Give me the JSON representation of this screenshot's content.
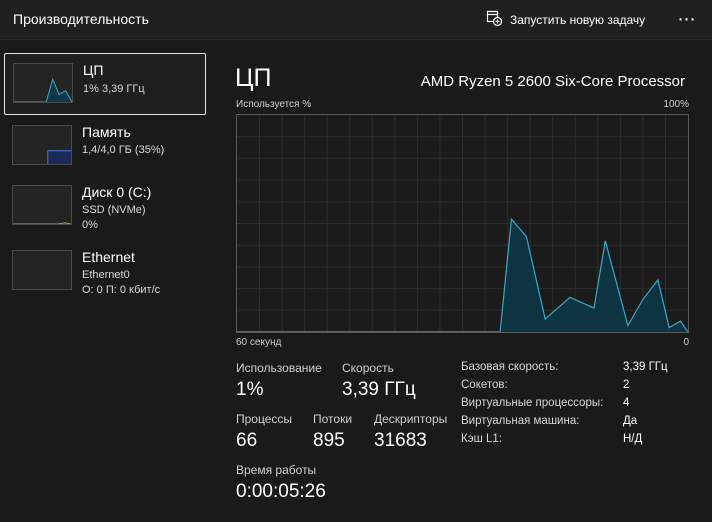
{
  "header": {
    "title": "Производительность",
    "new_task_label": "Запустить новую задачу",
    "new_task_icon": "new-task-icon",
    "more_icon": "more-options-icon",
    "more_glyph": "⋯"
  },
  "sidebar": {
    "items": [
      {
        "name": "ЦП",
        "sub1": "1% 3,39 ГГц",
        "sub2": "",
        "active": true
      },
      {
        "name": "Память",
        "sub1": "1,4/4,0 ГБ (35%)",
        "sub2": "",
        "active": false
      },
      {
        "name": "Диск 0 (C:)",
        "sub1": "SSD (NVMe)",
        "sub2": "0%",
        "active": false
      },
      {
        "name": "Ethernet",
        "sub1": "Ethernet0",
        "sub2": "О: 0 П: 0 кбит/с",
        "active": false
      }
    ]
  },
  "main": {
    "title": "ЦП",
    "processor": "AMD Ryzen 5 2600 Six-Core Processor",
    "graph_label": "Используется %",
    "graph_max": "100%",
    "axis_left": "60 секунд",
    "axis_right": "0"
  },
  "chart_data": {
    "type": "area",
    "title": "",
    "ylabel": "Используется %",
    "ylim": [
      0,
      100
    ],
    "x_range_seconds": [
      60,
      0
    ],
    "series": [
      {
        "x": [
          0,
          35,
          36.5,
          38.5,
          41,
          44.3,
          47.5,
          49,
          52,
          54,
          56,
          57.5,
          59,
          60
        ],
        "values": [
          0,
          0,
          52,
          44,
          6,
          16,
          11,
          42,
          3,
          15,
          24,
          2,
          5,
          0
        ]
      }
    ],
    "colors": {
      "line": "#37a8c9",
      "fill": "#0e3442",
      "grid": "#2d2d2d"
    },
    "grid": true
  },
  "stats": {
    "usage_label": "Использование",
    "usage_value": "1%",
    "speed_label": "Скорость",
    "speed_value": "3,39 ГГц",
    "processes_label": "Процессы",
    "processes_value": "66",
    "threads_label": "Потоки",
    "threads_value": "895",
    "handles_label": "Дескрипторы",
    "handles_value": "31683",
    "uptime_label": "Время работы",
    "uptime_value": "0:00:05:26"
  },
  "specs": [
    {
      "label": "Базовая скорость:",
      "value": "3,39 ГГц"
    },
    {
      "label": "Сокетов:",
      "value": "2"
    },
    {
      "label": "Виртуальные процессоры:",
      "value": "4"
    },
    {
      "label": "Виртуальная машина:",
      "value": "Да"
    },
    {
      "label": "Кэш L1:",
      "value": "Н/Д"
    }
  ],
  "mini_graphs": {
    "cpu": [
      0,
      0,
      0,
      0,
      40,
      10,
      60,
      20,
      30,
      0
    ],
    "memory_percent": 35,
    "disk": [
      0,
      0,
      0,
      0,
      0,
      0,
      0,
      0,
      3,
      0
    ]
  },
  "colors": {
    "cpu": "#37a8c9",
    "memory": "#4c7bd9",
    "disk": "#8fb33a"
  }
}
